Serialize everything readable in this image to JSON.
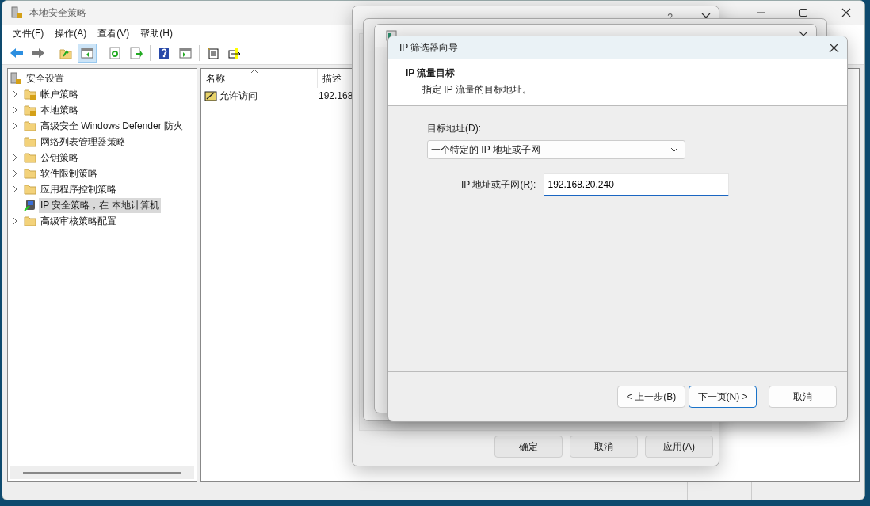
{
  "main_window": {
    "title": "本地安全策略",
    "menu": [
      "文件(F)",
      "操作(A)",
      "查看(V)",
      "帮助(H)"
    ],
    "toolbar": [
      {
        "kind": "back",
        "pressed": false
      },
      {
        "kind": "forward",
        "pressed": false
      },
      {
        "kind": "sep"
      },
      {
        "kind": "up",
        "pressed": false
      },
      {
        "kind": "tree",
        "pressed": true
      },
      {
        "kind": "sep"
      },
      {
        "kind": "refresh",
        "pressed": false
      },
      {
        "kind": "export",
        "pressed": false
      },
      {
        "kind": "sep"
      },
      {
        "kind": "help",
        "pressed": false
      },
      {
        "kind": "panel",
        "pressed": false
      },
      {
        "kind": "sep"
      },
      {
        "kind": "newdoc",
        "pressed": false
      },
      {
        "kind": "move",
        "pressed": false
      }
    ],
    "tree": {
      "label": "安全设置",
      "kind": "locked-server",
      "children": [
        {
          "label": "帐户策略",
          "kind": "locked-folder",
          "has_children": true,
          "selected": false
        },
        {
          "label": "本地策略",
          "kind": "locked-folder",
          "has_children": true,
          "selected": false
        },
        {
          "label": "高级安全 Windows Defender 防火",
          "kind": "folder",
          "has_children": true,
          "selected": false
        },
        {
          "label": "网络列表管理器策略",
          "kind": "folder",
          "has_children": false,
          "selected": false
        },
        {
          "label": "公钥策略",
          "kind": "folder",
          "has_children": true,
          "selected": false
        },
        {
          "label": "软件限制策略",
          "kind": "folder",
          "has_children": true,
          "selected": false
        },
        {
          "label": "应用程序控制策略",
          "kind": "folder",
          "has_children": true,
          "selected": false
        },
        {
          "label": "IP 安全策略，在 本地计算机",
          "kind": "computer",
          "has_children": false,
          "selected": true
        },
        {
          "label": "高级审核策略配置",
          "kind": "folder",
          "has_children": true,
          "selected": false
        }
      ]
    },
    "table": {
      "columns": [
        {
          "label": "名称",
          "sorted": true
        },
        {
          "label": "描述",
          "sorted": false
        }
      ],
      "rows": [
        {
          "cells": [
            "允许访问",
            "192.168"
          ]
        }
      ]
    }
  },
  "properties_dialog": {
    "help": "?",
    "buttons": [
      "确定",
      "取消",
      "应用(A)"
    ]
  },
  "wizard": {
    "title": "IP 筛选器向导",
    "heading": "IP 流量目标",
    "subheading": "指定 IP 流量的目标地址。",
    "dest_label": "目标地址(D):",
    "dest_value": "一个特定的 IP 地址或子网",
    "ip_label": "IP 地址或子网(R):",
    "ip_value": "192.168.20.240",
    "buttons": [
      {
        "label": "< 上一步(B)",
        "focused": false
      },
      {
        "label": "下一页(N) >",
        "focused": true
      },
      {
        "label": "取消",
        "focused": false
      }
    ]
  }
}
